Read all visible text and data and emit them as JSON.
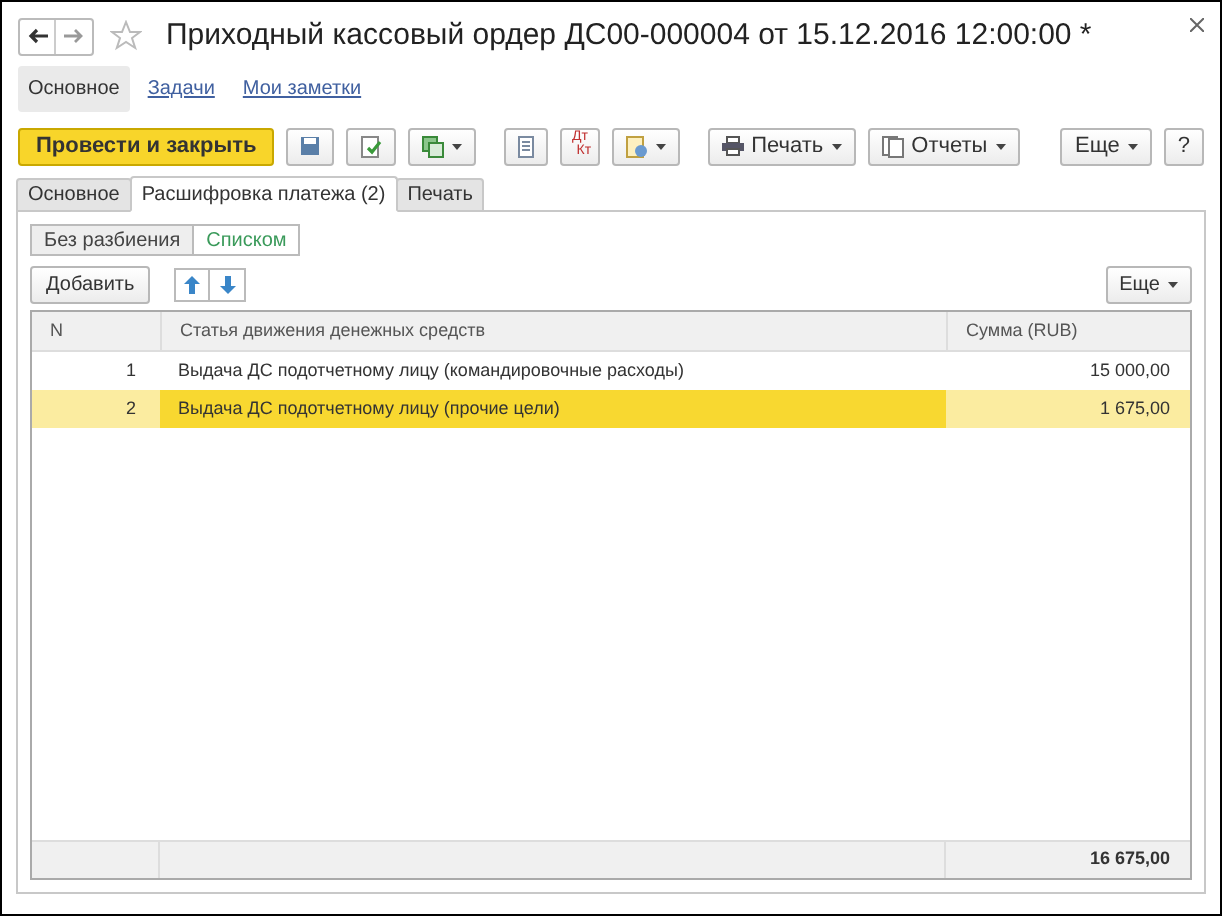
{
  "window": {
    "title": "Приходный кассовый ордер ДС00-000004 от 15.12.2016 12:00:00 *",
    "favorite": false
  },
  "nav": [
    {
      "label": "Основное",
      "selected": true
    },
    {
      "label": "Задачи",
      "selected": false
    },
    {
      "label": "Мои заметки",
      "selected": false
    }
  ],
  "toolbar": {
    "primary": "Провести и закрыть",
    "dt": "Дт",
    "kt": "Кт",
    "print": "Печать",
    "reports": "Отчеты",
    "more": "Еще",
    "help": "?"
  },
  "tabs": [
    {
      "label": "Основное",
      "selected": false
    },
    {
      "label": "Расшифровка платежа (2)",
      "selected": true
    },
    {
      "label": "Печать",
      "selected": false
    }
  ],
  "mode": [
    {
      "label": "Без разбиения",
      "selected": false
    },
    {
      "label": "Списком",
      "selected": true
    }
  ],
  "table_toolbar": {
    "add": "Добавить",
    "more": "Еще"
  },
  "table": {
    "columns": [
      "N",
      "Статья движения денежных средств",
      "Сумма (RUB)"
    ],
    "rows": [
      {
        "n": "1",
        "item": "Выдача ДС подотчетному лицу (командировочные расходы)",
        "sum": "15 000,00",
        "selected": false
      },
      {
        "n": "2",
        "item": "Выдача ДС подотчетному лицу (прочие цели)",
        "sum": "1 675,00",
        "selected": true
      }
    ],
    "total": "16 675,00"
  }
}
